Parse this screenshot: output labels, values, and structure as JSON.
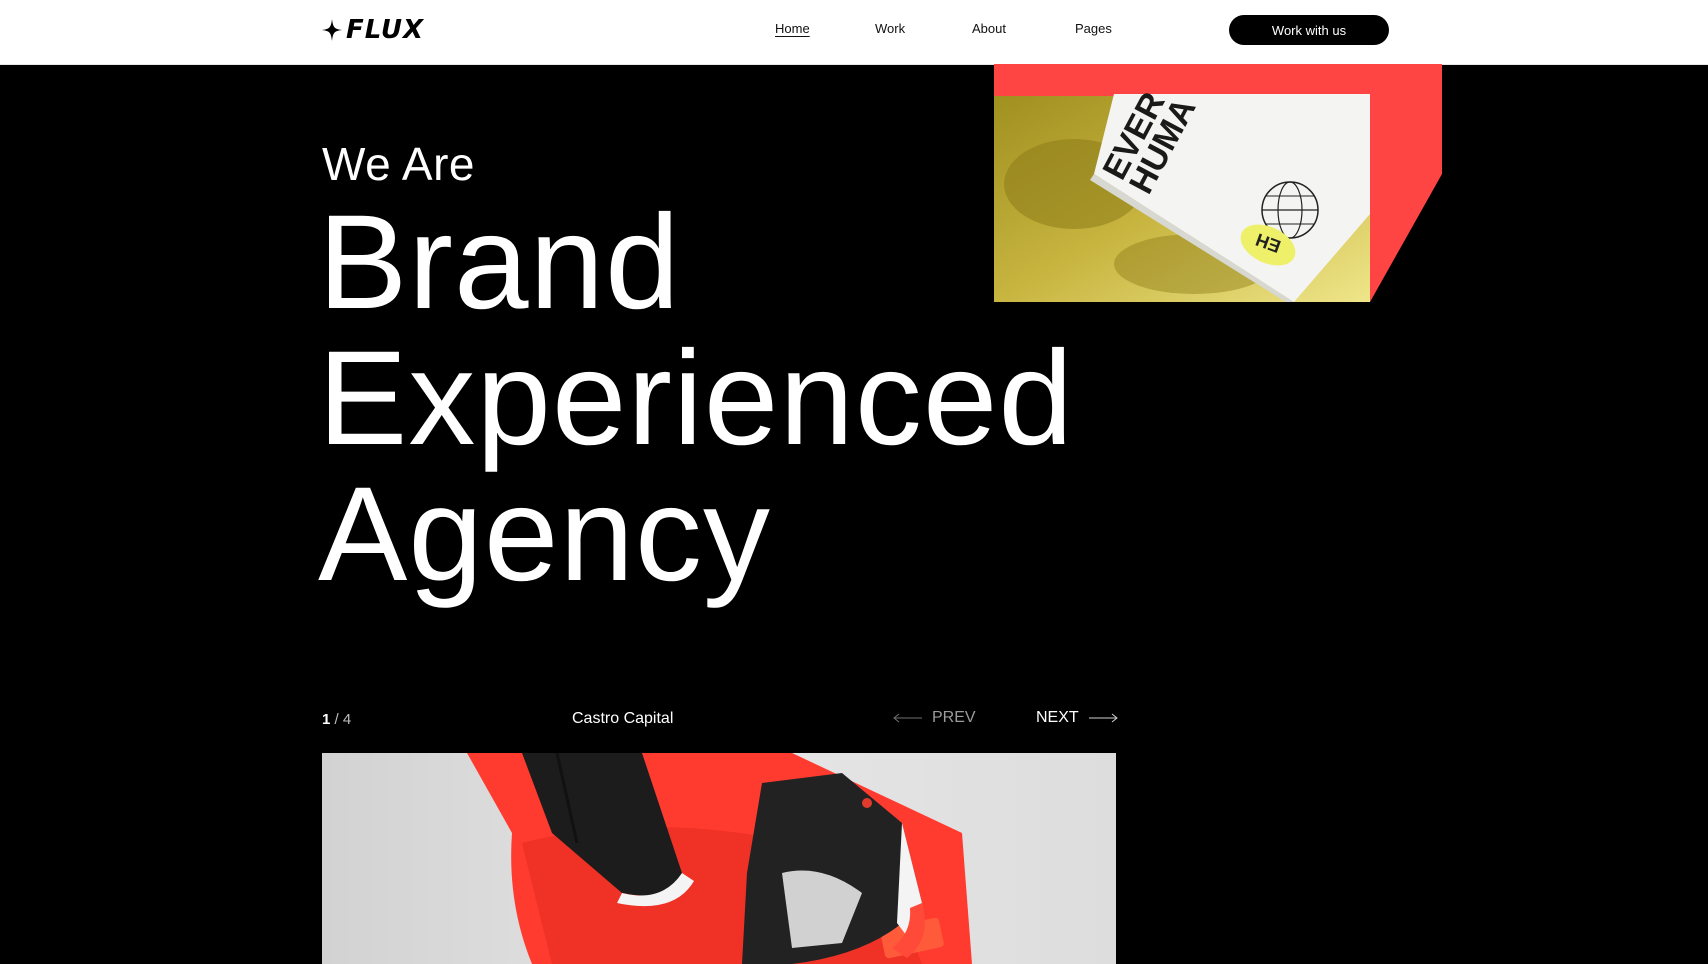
{
  "brand": {
    "logo_text": "FLUX",
    "logo_icon": "sparkle-icon"
  },
  "nav": {
    "items": [
      {
        "label": "Home",
        "active": true
      },
      {
        "label": "Work",
        "active": false
      },
      {
        "label": "About",
        "active": false
      },
      {
        "label": "Pages",
        "active": false
      }
    ],
    "cta_label": "Work with us"
  },
  "hero": {
    "eyebrow": "We Are",
    "headline_lines": [
      "Brand",
      "Experienced",
      "Agency"
    ],
    "image": {
      "box_text_lines": [
        "EVER",
        "HUMA"
      ],
      "badge": "EH"
    }
  },
  "slider": {
    "current": "1",
    "separator": "/",
    "total": "4",
    "title": "Castro Capital",
    "prev_label": "PREV",
    "next_label": "NEXT"
  },
  "colors": {
    "accent": "#ff4444",
    "background": "#000000",
    "header_bg": "#ffffff"
  }
}
